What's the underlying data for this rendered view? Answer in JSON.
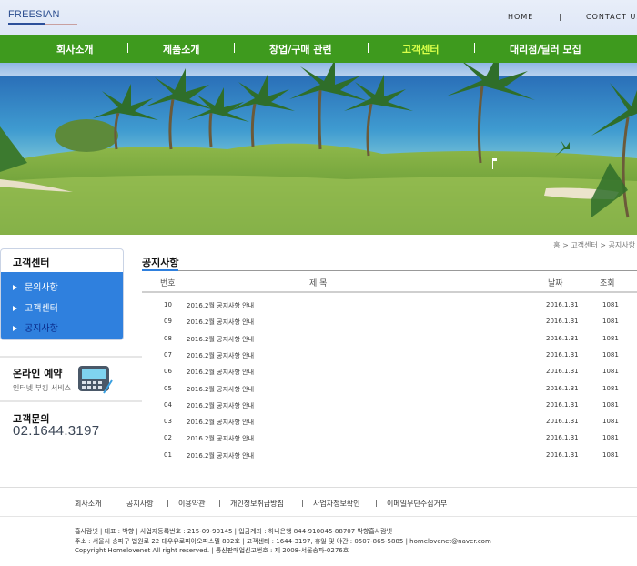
{
  "header": {
    "logo": "FREESIAN",
    "home": "HOME",
    "separator": "|",
    "contact": "CONTACT US"
  },
  "nav": {
    "items": [
      "회사소개",
      "제품소개",
      "창업/구매 관련",
      "고객센터",
      "대리점/딜러 모집"
    ],
    "separator": "|",
    "active_index": 3
  },
  "breadcrumb": "홈 > 고객센터 > 공지사항",
  "sidebar": {
    "title": "고객센터",
    "items": [
      "문의사항",
      "고객센터",
      "공지사항"
    ],
    "active_index": 2,
    "reserve_title": "온라인 예약",
    "reserve_sub": "인터넷 부킹 서비스",
    "contact_title": "고객문의",
    "contact_phone": "02.1644.3197"
  },
  "board": {
    "title": "공지사항",
    "columns": {
      "num": "번호",
      "subject": "제 목",
      "date": "날짜",
      "views": "조회"
    },
    "rows": [
      {
        "num": "10",
        "subject": "2016.2월 공지사항 안내",
        "date": "2016.1.31",
        "views": "1081"
      },
      {
        "num": "09",
        "subject": "2016.2월 공지사항 안내",
        "date": "2016.1.31",
        "views": "1081"
      },
      {
        "num": "08",
        "subject": "2016.2월 공지사항 안내",
        "date": "2016.1.31",
        "views": "1081"
      },
      {
        "num": "07",
        "subject": "2016.2월 공지사항 안내",
        "date": "2016.1.31",
        "views": "1081"
      },
      {
        "num": "06",
        "subject": "2016.2월 공지사항 안내",
        "date": "2016.1.31",
        "views": "1081"
      },
      {
        "num": "05",
        "subject": "2016.2월 공지사항 안내",
        "date": "2016.1.31",
        "views": "1081"
      },
      {
        "num": "04",
        "subject": "2016.2월 공지사항 안내",
        "date": "2016.1.31",
        "views": "1081"
      },
      {
        "num": "03",
        "subject": "2016.2월 공지사항 안내",
        "date": "2016.1.31",
        "views": "1081"
      },
      {
        "num": "02",
        "subject": "2016.2월 공지사항 안내",
        "date": "2016.1.31",
        "views": "1081"
      },
      {
        "num": "01",
        "subject": "2016.2월 공지사항 안내",
        "date": "2016.1.31",
        "views": "1081"
      }
    ]
  },
  "footer": {
    "links": [
      "회사소개",
      "|",
      "공지사항",
      "|",
      "이용약관",
      "|",
      "개인정보취급방침",
      "|",
      "사업자정보확인",
      "|",
      "이메일무단수집거부"
    ],
    "info": [
      "홈사람넷 | 대표 : 박향 | 사업자등록번호 : 215-09-90145 | 입금계좌 : 하나은행 844-910045-88707 박향홈사람넷",
      "주소 : 서울시 송파구 법원로 22 대우유로피아오피스텔 802호 | 고객센터 : 1644-3197, 휴일 및 야간 : 0507-865-5885 | homelovenet@naver.com",
      "Copyright Homelovenet All right reserved. | 통신판매업신고번호 : 제 2008-서울송파-0276호"
    ]
  },
  "colors": {
    "nav_bg": "#3e9a1e",
    "nav_active": "#d9ff4a",
    "side_menu_bg": "#2f80de",
    "accent_blue": "#2f80de"
  }
}
